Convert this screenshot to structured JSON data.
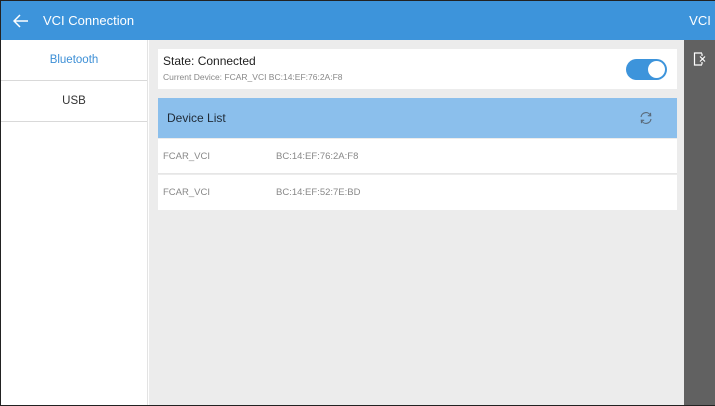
{
  "header": {
    "title": "VCI Connection"
  },
  "side_strip": {
    "title": "VCI"
  },
  "tabs": [
    {
      "label": "Bluetooth",
      "active": true
    },
    {
      "label": "USB",
      "active": false
    }
  ],
  "state": {
    "title": "State: Connected",
    "current_device": "Current Device: FCAR_VCI BC:14:EF:76:2A:F8",
    "toggle_on": true
  },
  "device_list": {
    "title": "Device List",
    "devices": [
      {
        "name": "FCAR_VCI",
        "mac": "BC:14:EF:76:2A:F8"
      },
      {
        "name": "FCAR_VCI",
        "mac": "BC:14:EF:52:7E:BD"
      }
    ]
  },
  "colors": {
    "accent": "#3d94db",
    "list_header": "#8bbfec",
    "strip": "#616161"
  },
  "icons": {
    "back": "arrow-left-icon",
    "refresh": "refresh-icon",
    "exit": "exit-icon"
  }
}
